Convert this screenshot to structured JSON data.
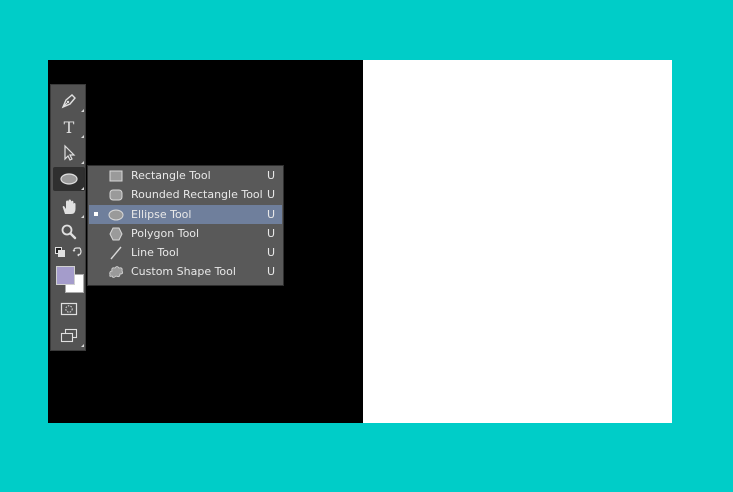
{
  "colors": {
    "background": "#00cdc8",
    "canvas_left": "#000000",
    "canvas_right": "#ffffff",
    "toolbar": "#535353",
    "flyout": "#595959",
    "flyout_selected": "#6f7f9c",
    "foreground_swatch": "#a49ccb",
    "background_swatch": "#ffffff"
  },
  "toolbar": {
    "tools": [
      {
        "name": "pen-tool",
        "icon": "pen-icon"
      },
      {
        "name": "type-tool",
        "icon": "type-icon",
        "glyph": "T"
      },
      {
        "name": "path-selection-tool",
        "icon": "arrow-cursor-icon"
      },
      {
        "name": "shape-tool",
        "icon": "ellipse-icon",
        "active": true
      },
      {
        "name": "hand-tool",
        "icon": "hand-icon"
      },
      {
        "name": "zoom-tool",
        "icon": "magnifier-icon"
      },
      {
        "name": "default-colors",
        "icon": "default-colors-icon"
      },
      {
        "name": "swap-colors",
        "icon": "swap-arrows-icon"
      },
      {
        "name": "foreground-color",
        "icon": "color-swatch"
      },
      {
        "name": "background-color",
        "icon": "color-swatch"
      },
      {
        "name": "quick-mask",
        "icon": "quick-mask-icon"
      },
      {
        "name": "screen-mode",
        "icon": "screen-mode-icon"
      }
    ]
  },
  "flyout": {
    "items": [
      {
        "label": "Rectangle Tool",
        "shortcut": "U",
        "icon": "rectangle-icon",
        "selected": false
      },
      {
        "label": "Rounded Rectangle Tool",
        "shortcut": "U",
        "icon": "rounded-rectangle-icon",
        "selected": false
      },
      {
        "label": "Ellipse Tool",
        "shortcut": "U",
        "icon": "ellipse-icon",
        "selected": true
      },
      {
        "label": "Polygon Tool",
        "shortcut": "U",
        "icon": "polygon-icon",
        "selected": false
      },
      {
        "label": "Line Tool",
        "shortcut": "U",
        "icon": "line-icon",
        "selected": false
      },
      {
        "label": "Custom Shape Tool",
        "shortcut": "U",
        "icon": "custom-shape-icon",
        "selected": false
      }
    ]
  }
}
